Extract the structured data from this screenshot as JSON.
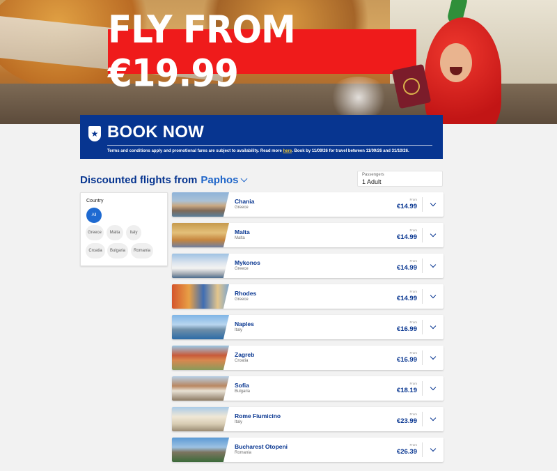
{
  "hero": {
    "headline": "FLY FROM €19.99"
  },
  "banner": {
    "title": "BOOK NOW",
    "terms_prefix": "Terms and conditions apply and promotional fares are subject to availability. Read more ",
    "terms_link": "here",
    "terms_suffix": ". Book by 11/09/26 for travel between 11/09/26 and 31/10/26."
  },
  "section": {
    "title": "Discounted flights from",
    "origin": "Paphos"
  },
  "passengers": {
    "label": "Passengers",
    "value": "1 Adult"
  },
  "filter": {
    "label": "Country",
    "chips": [
      "All",
      "Greece",
      "Malta",
      "Italy",
      "Croatia",
      "Bulgaria",
      "Romania"
    ],
    "selected": "All"
  },
  "flights": [
    {
      "city": "Chania",
      "country": "Greece",
      "from_label": "From",
      "price": "€14.99"
    },
    {
      "city": "Malta",
      "country": "Malta",
      "from_label": "From",
      "price": "€14.99"
    },
    {
      "city": "Mykonos",
      "country": "Greece",
      "from_label": "From",
      "price": "€14.99"
    },
    {
      "city": "Rhodes",
      "country": "Greece",
      "from_label": "From",
      "price": "€14.99"
    },
    {
      "city": "Naples",
      "country": "Italy",
      "from_label": "From",
      "price": "€16.99"
    },
    {
      "city": "Zagreb",
      "country": "Croatia",
      "from_label": "From",
      "price": "€16.99"
    },
    {
      "city": "Sofia",
      "country": "Bulgaria",
      "from_label": "From",
      "price": "€18.19"
    },
    {
      "city": "Rome Fiumicino",
      "country": "Italy",
      "from_label": "From",
      "price": "€23.99"
    },
    {
      "city": "Bucharest Otopeni",
      "country": "Romania",
      "from_label": "From",
      "price": "€26.39"
    }
  ],
  "colors": {
    "brand_blue": "#073590",
    "headline_red": "#ef1b1b",
    "accent_yellow": "#f1c933",
    "chip_selected": "#1e6ad1"
  }
}
